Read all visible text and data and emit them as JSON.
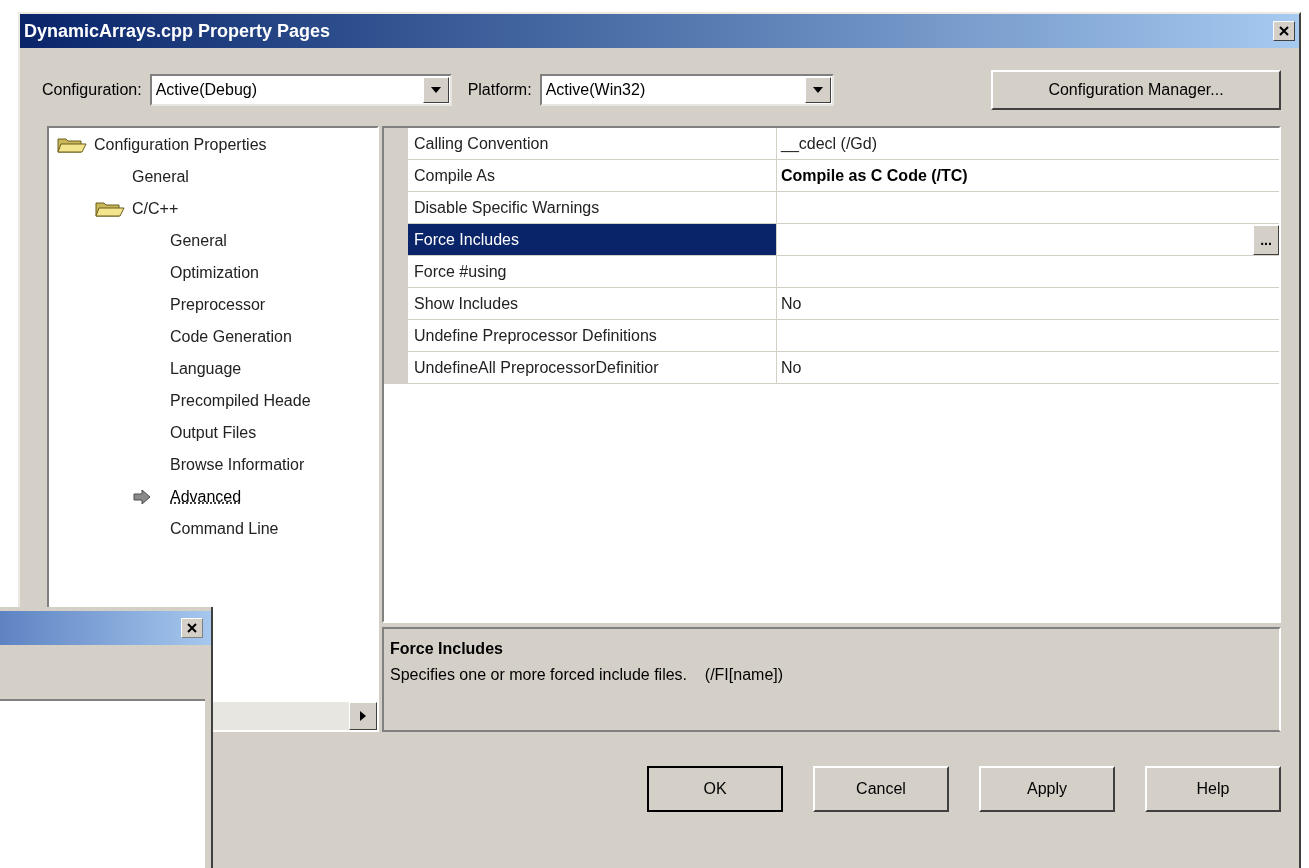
{
  "window": {
    "title": "DynamicArrays.cpp Property Pages"
  },
  "configuration": {
    "label": "Configuration:",
    "value": "Active(Debug)"
  },
  "platform": {
    "label": "Platform:",
    "value": "Active(Win32)"
  },
  "config_manager_button": "Configuration Manager...",
  "tree": [
    {
      "label": "Configuration Properties",
      "selected": false,
      "children": [
        {
          "label": "General",
          "selected": false
        },
        {
          "label": "C/C++",
          "selected": false,
          "children": [
            {
              "label": "General",
              "selected": false
            },
            {
              "label": "Optimization",
              "selected": false
            },
            {
              "label": "Preprocessor",
              "selected": false
            },
            {
              "label": "Code Generation",
              "selected": false
            },
            {
              "label": "Language",
              "selected": false
            },
            {
              "label": "Precompiled Heade",
              "selected": false
            },
            {
              "label": "Output Files",
              "selected": false
            },
            {
              "label": "Browse Informatior",
              "selected": false
            },
            {
              "label": "Advanced",
              "selected": true
            },
            {
              "label": "Command Line",
              "selected": false
            }
          ]
        }
      ]
    }
  ],
  "properties": [
    {
      "name": "Calling Convention",
      "value": "__cdecl (/Gd)",
      "bold": false,
      "selected": false
    },
    {
      "name": "Compile As",
      "value": "Compile as C Code (/TC)",
      "bold": true,
      "selected": false
    },
    {
      "name": "Disable Specific Warnings",
      "selected": false
    },
    {
      "name": "Force Includes",
      "selected": true,
      "button": "..."
    },
    {
      "name": "Force #using",
      "selected": false
    },
    {
      "name": "Show Includes",
      "value": "No",
      "bold": false,
      "selected": false
    },
    {
      "name": "Undefine Preprocessor Definitions",
      "selected": false
    },
    {
      "name": "UndefineAll PreprocessorDefinitior",
      "value": "No",
      "bold": false,
      "selected": false
    }
  ],
  "description": {
    "title": "Force Includes",
    "text": "Specifies one or more forced include files.    (/FI[name])"
  },
  "buttons": [
    {
      "label": "OK",
      "default": true
    },
    {
      "label": "Cancel",
      "default": false
    },
    {
      "label": "Apply",
      "default": false
    },
    {
      "label": "Help",
      "default": false
    }
  ]
}
